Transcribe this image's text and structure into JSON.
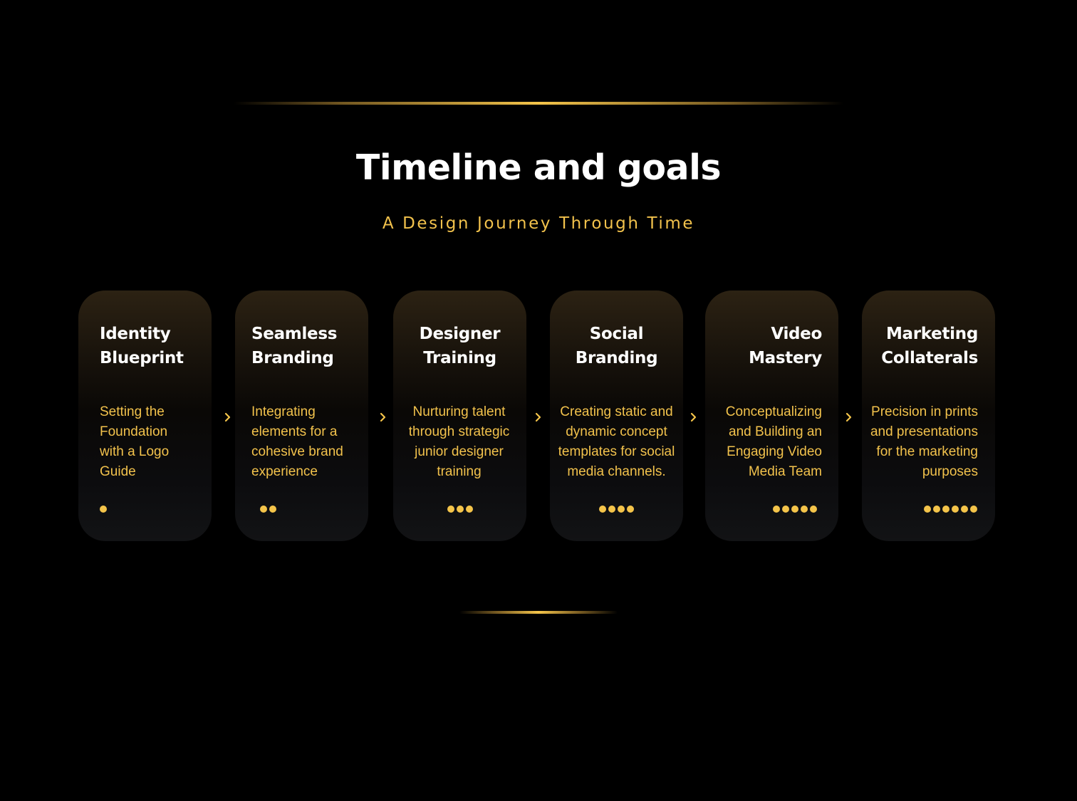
{
  "header": {
    "title": "Timeline and goals",
    "subtitle": "A Design Journey Through Time"
  },
  "colors": {
    "accent": "#f4c44a",
    "background": "#000000",
    "title_text": "#ffffff"
  },
  "icons": {
    "chevron": "chevron-right-icon",
    "step_indicator": "dot-icon"
  },
  "cards": [
    {
      "title": "Identity\nBlueprint",
      "description": "Setting the\nFoundation\nwith a Logo\nGuide",
      "step": 1
    },
    {
      "title": "Seamless\nBranding",
      "description": "Integrating\nelements for a\ncohesive brand\nexperience",
      "step": 2
    },
    {
      "title": "Designer\nTraining",
      "description": "Nurturing talent\nthrough strategic\njunior designer\ntraining",
      "step": 3
    },
    {
      "title": "Social\nBranding",
      "description": "Creating static and\ndynamic concept\ntemplates for social\nmedia channels.",
      "step": 4
    },
    {
      "title": "Video\nMastery",
      "description": "Conceptualizing\nand Building an\nEngaging Video\nMedia Team",
      "step": 5
    },
    {
      "title": "Marketing\nCollaterals",
      "description": "Precision in prints\nand presentations\nfor the marketing\npurposes",
      "step": 6
    }
  ]
}
